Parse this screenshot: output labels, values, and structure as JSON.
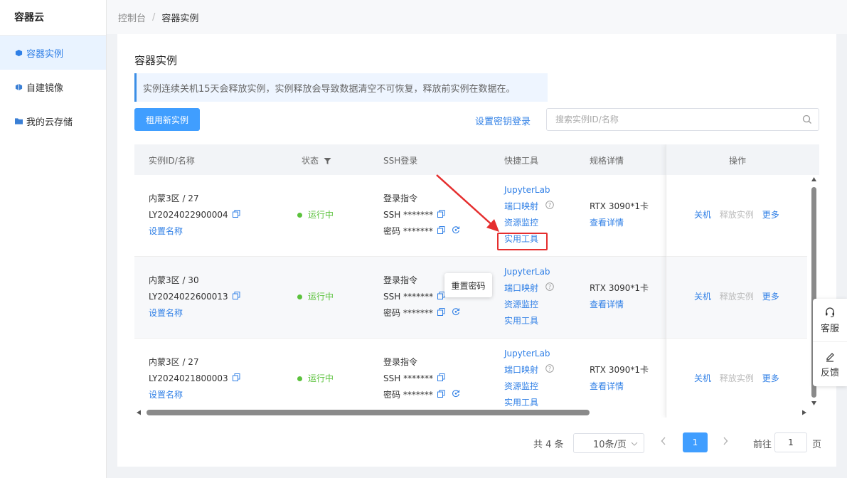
{
  "app": {
    "title": "容器云"
  },
  "sidebar": {
    "items": [
      {
        "label": "容器实例",
        "icon": "cube-icon",
        "active": true
      },
      {
        "label": "自建镜像",
        "icon": "image-icon",
        "active": false
      },
      {
        "label": "我的云存储",
        "icon": "folder-icon",
        "active": false
      }
    ]
  },
  "breadcrumb": {
    "root": "控制台",
    "separator": "/",
    "current": "容器实例"
  },
  "page": {
    "title": "容器实例",
    "notice": "实例连续关机15天会释放实例，实例释放会导致数据清空不可恢复，释放前实例在数据在。",
    "rent_button": "租用新实例",
    "key_login_link": "设置密钥登录",
    "search_placeholder": "搜索实例ID/名称"
  },
  "table": {
    "headers": {
      "id": "实例ID/名称",
      "status": "状态",
      "ssh": "SSH登录",
      "tools": "快捷工具",
      "spec": "规格详情",
      "actions": "操作"
    },
    "rows": [
      {
        "region": "内蒙3区 / 27",
        "id": "LY2024022900004",
        "set_name": "设置名称",
        "status": "运行中",
        "login_cmd": "登录指令",
        "ssh": "SSH *******",
        "password": "密码 *******",
        "tools": [
          "JupyterLab",
          "端口映射",
          "资源监控",
          "实用工具"
        ],
        "spec": "RTX 3090*1卡",
        "spec_link": "查看详情",
        "actions": [
          "关机",
          "释放实例",
          "更多"
        ]
      },
      {
        "region": "内蒙3区 / 30",
        "id": "LY2024022600013",
        "set_name": "设置名称",
        "status": "运行中",
        "login_cmd": "登录指令",
        "ssh": "SSH *******",
        "password": "密码 *******",
        "tools": [
          "JupyterLab",
          "端口映射",
          "资源监控",
          "实用工具"
        ],
        "spec": "RTX 3090*1卡",
        "spec_link": "查看详情",
        "actions": [
          "关机",
          "释放实例",
          "更多"
        ]
      },
      {
        "region": "内蒙3区 / 27",
        "id": "LY2024021800003",
        "set_name": "设置名称",
        "status": "运行中",
        "login_cmd": "登录指令",
        "ssh": "SSH *******",
        "password": "密码 *******",
        "tools": [
          "JupyterLab",
          "端口映射",
          "资源监控",
          "实用工具"
        ],
        "spec": "RTX 3090*1卡",
        "spec_link": "查看详情",
        "actions": [
          "关机",
          "释放实例",
          "更多"
        ]
      }
    ]
  },
  "tooltip": {
    "text": "重置密码"
  },
  "pagination": {
    "total": "共 4 条",
    "page_size": "10条/页",
    "current_page": "1",
    "goto_label": "前往",
    "goto_value": "1",
    "goto_unit": "页"
  },
  "float_panel": {
    "service": "客服",
    "feedback": "反馈"
  },
  "colors": {
    "primary": "#409eff",
    "link": "#2f7fe6",
    "running": "#5bc23c",
    "highlight": "#e52e2e"
  }
}
